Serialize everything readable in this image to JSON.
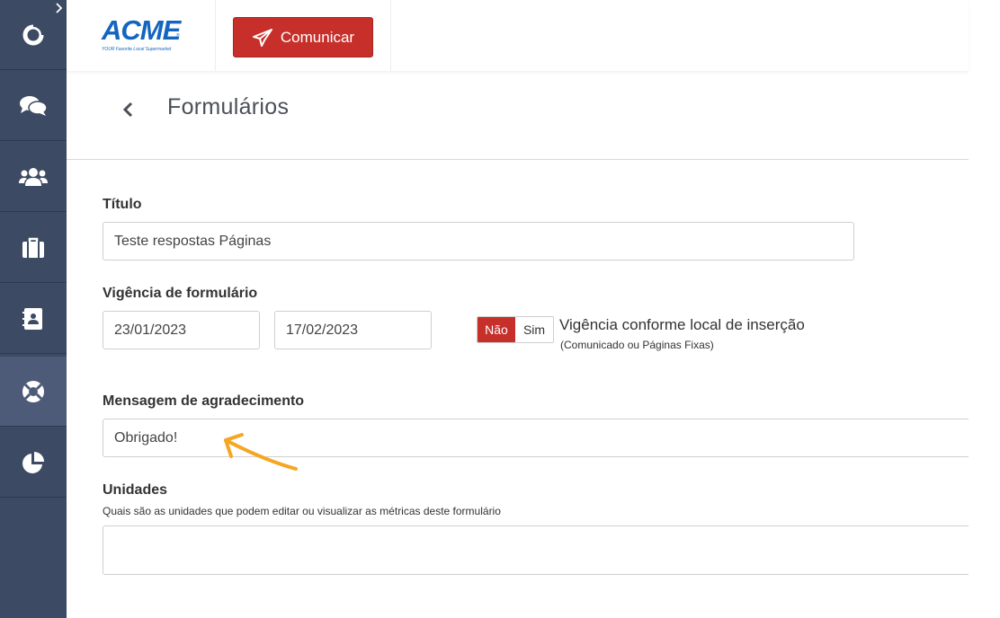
{
  "header": {
    "logo_text": "ACME",
    "logo_tagline": "YOUR Favorite Local Supermarket",
    "communicate_label": "Comunicar"
  },
  "sidebar": {
    "items": [
      {
        "name": "home",
        "icon": "brand-ring-icon"
      },
      {
        "name": "chat",
        "icon": "chat-bubbles-icon"
      },
      {
        "name": "people",
        "icon": "users-icon"
      },
      {
        "name": "jobs",
        "icon": "briefcase-icon"
      },
      {
        "name": "contacts",
        "icon": "address-book-icon"
      },
      {
        "name": "forms",
        "icon": "support-ring-icon",
        "active": true
      },
      {
        "name": "reports",
        "icon": "pie-chart-icon"
      }
    ],
    "bg_color": "#3d4a63",
    "active_color": "#4d5b78"
  },
  "page": {
    "title": "Formulários"
  },
  "form": {
    "title_label": "Título",
    "title_value": "Teste respostas Páginas",
    "validity_label": "Vigência de formulário",
    "start_date": "23/01/2023",
    "end_date": "17/02/2023",
    "toggle_no": "Não",
    "toggle_yes": "Sim",
    "validity_option_text": "Vigência conforme local de inserção",
    "validity_option_sub": "(Comunicado ou Páginas Fixas)",
    "thanks_label": "Mensagem de agradecimento",
    "thanks_value": "Obrigado!",
    "units_label": "Unidades",
    "units_hint": "Quais são as unidades que podem editar ou visualizar as métricas deste formulário",
    "units_value": ""
  },
  "colors": {
    "accent_red": "#c62f2a",
    "brand_blue": "#1565c0",
    "annotation_arrow": "#f5a623"
  }
}
